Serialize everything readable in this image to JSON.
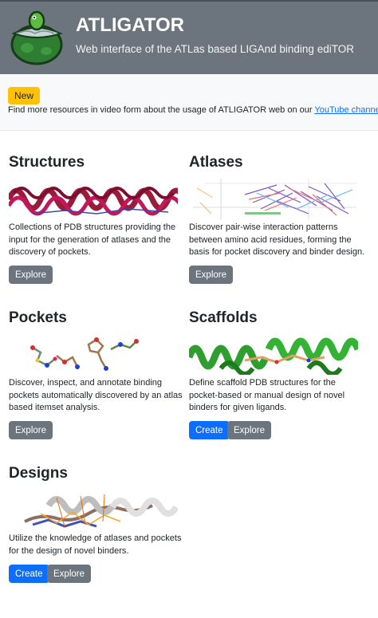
{
  "header": {
    "title": "ATLIGATOR",
    "subtitle": "Web interface of the ATLas based LIGAnd binding ediTOR"
  },
  "notice": {
    "badge": "New",
    "text": "Find more resources in video form about the usage of ATLIGATOR web on our ",
    "link": "YouTube channel!"
  },
  "cards": {
    "structures": {
      "title": "Structures",
      "description": "Collections of PDB structures providing the input for the generation of atlases and the discovery of pockets.",
      "explore": "Explore"
    },
    "atlases": {
      "title": "Atlases",
      "description": "Discover pair-wise interaction patterns between amino acid residues, forming the basis for pocket discovery and binder design.",
      "explore": "Explore"
    },
    "pockets": {
      "title": "Pockets",
      "description": "Discover, inspect, and annotate binding pockets automatically discovered by an atlas based itemset analysis.",
      "explore": "Explore"
    },
    "scaffolds": {
      "title": "Scaffolds",
      "description": "Define scaffold PDB structures for the pocket-based or manual design of novel binders for given ligands.",
      "create": "Create",
      "explore": "Explore"
    },
    "designs": {
      "title": "Designs",
      "description": "Utilize the knowledge of atlases and pockets for the design of novel binders.",
      "create": "Create",
      "explore": "Explore"
    }
  },
  "colors": {
    "header_bg": "#6c757d",
    "badge_bg": "#ffc107",
    "primary": "#0d6efd",
    "secondary": "#6c757d",
    "link": "#0d6efd"
  },
  "icons": {
    "logo": "alligator-logo"
  }
}
